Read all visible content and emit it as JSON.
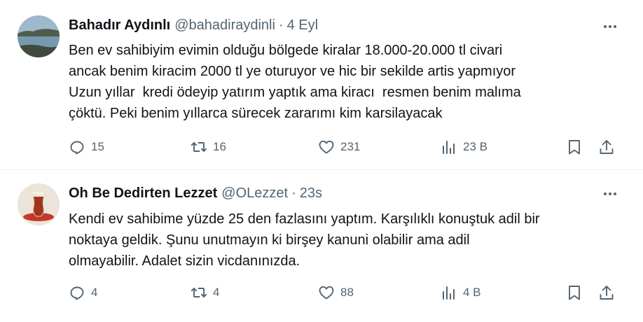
{
  "tweets": [
    {
      "author": "Bahadır Aydınlı",
      "handle": "@bahadiraydinli",
      "separator": "·",
      "time": "4 Eyl",
      "avatar_icon": "lake-landscape-avatar",
      "lines": [
        "Ben ev sahibiyim evimin olduğu bölgede kiralar 18.000-20.000 tl civari",
        "ancak benim kiracim 2000 tl ye oturuyor ve hic bir sekilde artis yapmıyor",
        "Uzun yıllar  kredi ödeyip yatırım yaptık ama kiracı  resmen benim malıma",
        "çöktü. Peki benim yıllarca sürecek zararımı kim karsilayacak"
      ],
      "replies": "15",
      "retweets": "16",
      "likes": "231",
      "views": "23 B"
    },
    {
      "author": "Oh Be Dedirten Lezzet",
      "handle": "@OLezzet",
      "separator": "·",
      "time": "23s",
      "avatar_icon": "tea-glass-avatar",
      "lines": [
        "Kendi ev sahibime yüzde 25 den fazlasını yaptım. Karşılıklı konuştuk adil bir",
        "noktaya geldik. Şunu unutmayın ki birşey kanuni olabilir ama adil",
        "olmayabilir. Adalet sizin vicdanınızda."
      ],
      "replies": "4",
      "retweets": "4",
      "likes": "88",
      "views": "4 B"
    }
  ],
  "colors": {
    "text": "#0f1419",
    "secondary": "#536471",
    "divider": "#eff3f4"
  }
}
